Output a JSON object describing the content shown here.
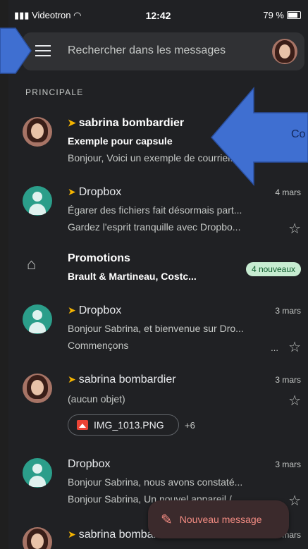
{
  "status_bar": {
    "carrier": "Videotron",
    "time": "12:42",
    "battery": "79 %"
  },
  "search": {
    "placeholder": "Rechercher dans les messages"
  },
  "section_label": "PRINCIPALE",
  "emails": [
    {
      "sender": "sabrina bombardier",
      "subject": "Exemple pour capsule",
      "snippet": "Bonjour, Voici un exemple de courriel...",
      "date": "",
      "important": true,
      "unread": true,
      "avatar": "photo"
    },
    {
      "sender": "Dropbox",
      "subject": "Égarer des fichiers fait désormais part...",
      "snippet": "Gardez l'esprit tranquille avec Dropbo...",
      "date": "4 mars",
      "important": true,
      "unread": false,
      "avatar": "teal"
    },
    {
      "sender": "Dropbox",
      "subject": "Bonjour Sabrina, et bienvenue sur Dro...",
      "snippet": "Commençons",
      "snippet_ellipsis": "...",
      "date": "3 mars",
      "important": true,
      "unread": false,
      "avatar": "teal"
    },
    {
      "sender": "sabrina bombardier",
      "subject": "(aucun objet)",
      "attachment": "IMG_1013.PNG",
      "attachment_more": "+6",
      "date": "3 mars",
      "important": true,
      "unread": false,
      "avatar": "photo"
    },
    {
      "sender": "Dropbox",
      "subject": "Bonjour Sabrina, nous avons constaté...",
      "snippet": "Bonjour Sabrina, Un nouvel appareil /...",
      "date": "3 mars",
      "important": false,
      "unread": false,
      "avatar": "teal"
    },
    {
      "sender": "sabrina bombardier",
      "date": "mars",
      "important": true,
      "unread": false,
      "avatar": "photo"
    }
  ],
  "promotions": {
    "title": "Promotions",
    "senders": "Brault & Martineau, Costc...",
    "badge": "4 nouveaux"
  },
  "compose": {
    "label": "Nouveau message"
  },
  "annotation": {
    "text": "Co",
    "color": "#3f6fd1"
  },
  "colors": {
    "background": "#202124",
    "important": "#f5b400",
    "badge": "#c7ecd1",
    "compose": "#f28b82"
  },
  "icons": {
    "menu": "menu-icon",
    "tag": "tag-icon",
    "star": "star-icon",
    "pencil": "pencil-icon",
    "image": "image-icon",
    "wifi": "wifi-icon",
    "signal": "signal-icon",
    "battery": "battery-icon"
  }
}
